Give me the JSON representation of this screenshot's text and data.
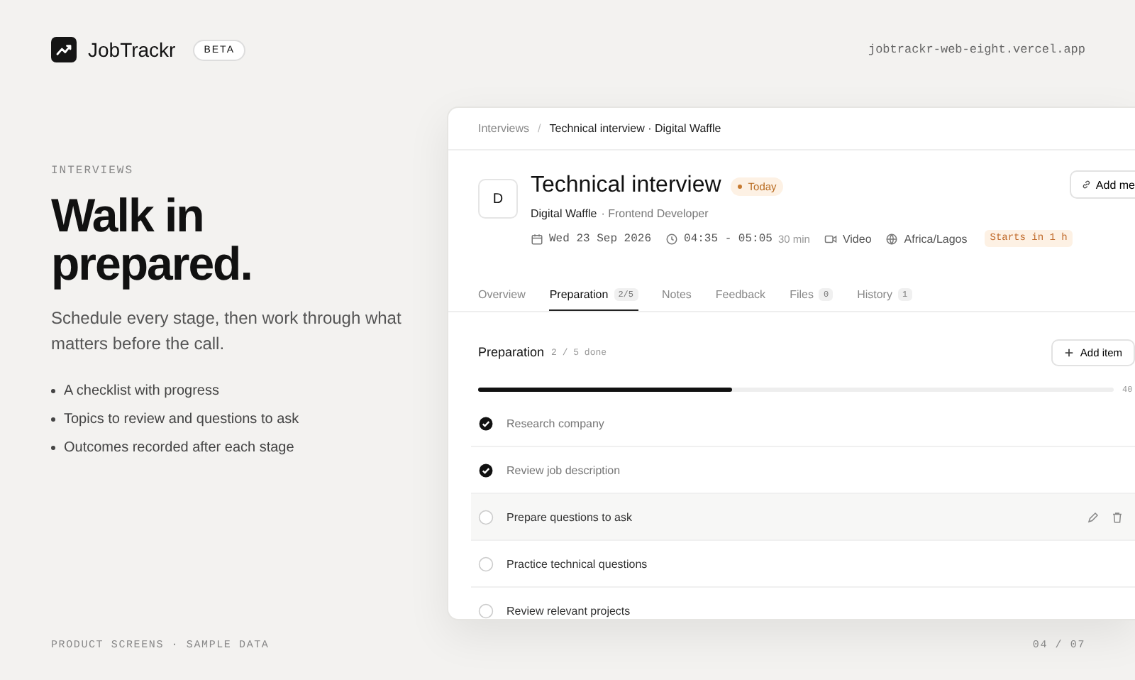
{
  "brand": {
    "name": "JobTrackr",
    "badge": "BETA"
  },
  "site_url": "jobtrackr-web-eight.vercel.app",
  "hero": {
    "eyebrow": "INTERVIEWS",
    "title": "Walk in prepared.",
    "subtitle": "Schedule every stage, then work through what matters before the call.",
    "bullets": [
      "A checklist with progress",
      "Topics to review and questions to ask",
      "Outcomes recorded after each stage"
    ]
  },
  "breadcrumb": {
    "parent": "Interviews",
    "separator": "/",
    "current": "Technical interview · Digital Waffle"
  },
  "interview": {
    "avatar_letter": "D",
    "title": "Technical interview",
    "status_badge": "Today",
    "company": "Digital Waffle",
    "role": "· Frontend Developer",
    "date": "Wed 23 Sep 2026",
    "time": "04:35 - 05:05",
    "duration": "30 min",
    "mode": "Video",
    "timezone": "Africa/Lagos",
    "starts_in": "Starts in 1 h",
    "action_button": "Add me"
  },
  "tabs": [
    {
      "label": "Overview",
      "selected": false
    },
    {
      "label": "Preparation",
      "count": "2/5",
      "selected": true
    },
    {
      "label": "Notes",
      "selected": false
    },
    {
      "label": "Feedback",
      "selected": false
    },
    {
      "label": "Files",
      "count": "0",
      "selected": false
    },
    {
      "label": "History",
      "count": "1",
      "selected": false
    }
  ],
  "checklist": {
    "title": "Preparation",
    "count": "2 / 5 done",
    "add_button": "Add item",
    "progress": {
      "level": 0.4,
      "reading": "40"
    },
    "items": [
      {
        "label": "Research company",
        "checked": true,
        "hovered": false
      },
      {
        "label": "Review job description",
        "checked": true,
        "hovered": false
      },
      {
        "label": "Prepare questions to ask",
        "checked": false,
        "hovered": true
      },
      {
        "label": "Practice technical questions",
        "checked": false,
        "hovered": false
      },
      {
        "label": "Review relevant projects",
        "checked": false,
        "hovered": false
      }
    ]
  },
  "footer": {
    "left": "PRODUCT SCREENS · SAMPLE DATA",
    "right": "04 / 07"
  }
}
